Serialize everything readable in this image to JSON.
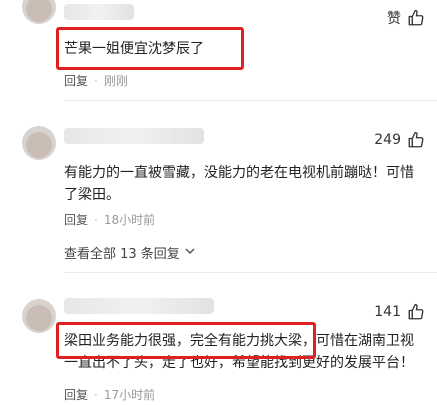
{
  "comments": [
    {
      "like_label": "赞",
      "text": "芒果一姐便宜沈梦辰了",
      "reply_label": "回复",
      "time": "刚刚"
    },
    {
      "like_count": "249",
      "text": "有能力的一直被雪藏，没能力的老在电视机前蹦哒！可惜了梁田。",
      "reply_label": "回复",
      "time": "18小时前",
      "view_replies": "查看全部 13 条回复"
    },
    {
      "like_count": "141",
      "text": "梁田业务能力很强，完全有能力挑大梁，可惜在湖南卫视一直出不了头，走了也好，希望能找到更好的发展平台！",
      "reply_label": "回复",
      "time": "17小时前"
    }
  ],
  "colors": {
    "highlight_box": "#e02020",
    "text": "#222222",
    "muted": "#999999"
  }
}
